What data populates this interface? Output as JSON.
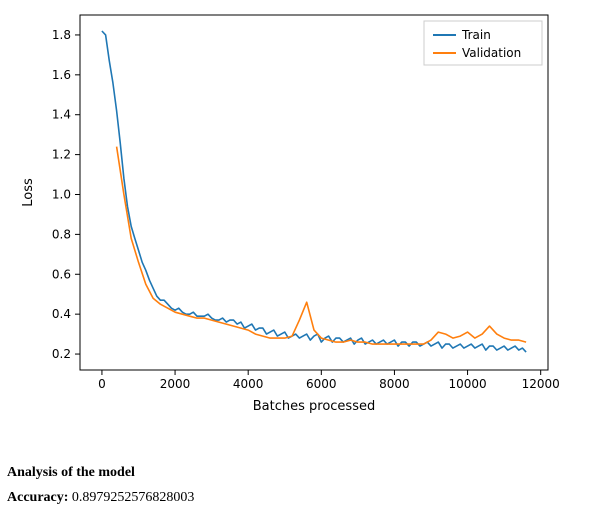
{
  "chart_data": {
    "type": "line",
    "title": "",
    "xlabel": "Batches processed",
    "ylabel": "Loss",
    "xlim": [
      -600,
      12200
    ],
    "ylim": [
      0.12,
      1.9
    ],
    "x_ticks": [
      0,
      2000,
      4000,
      6000,
      8000,
      10000,
      12000
    ],
    "y_ticks": [
      0.2,
      0.4,
      0.6,
      0.8,
      1.0,
      1.2,
      1.4,
      1.6,
      1.8
    ],
    "series": [
      {
        "name": "Train",
        "color": "#1f77b4",
        "x": [
          0,
          100,
          200,
          300,
          400,
          500,
          600,
          700,
          800,
          900,
          1000,
          1100,
          1200,
          1300,
          1400,
          1500,
          1600,
          1700,
          1800,
          1900,
          2000,
          2100,
          2200,
          2300,
          2400,
          2500,
          2600,
          2700,
          2800,
          2900,
          3000,
          3100,
          3200,
          3300,
          3400,
          3500,
          3600,
          3700,
          3800,
          3900,
          4000,
          4100,
          4200,
          4300,
          4400,
          4500,
          4600,
          4700,
          4800,
          4900,
          5000,
          5100,
          5200,
          5300,
          5400,
          5500,
          5600,
          5700,
          5800,
          5900,
          6000,
          6100,
          6200,
          6300,
          6400,
          6500,
          6600,
          6700,
          6800,
          6900,
          7000,
          7100,
          7200,
          7300,
          7400,
          7500,
          7600,
          7700,
          7800,
          7900,
          8000,
          8100,
          8200,
          8300,
          8400,
          8500,
          8600,
          8700,
          8800,
          8900,
          9000,
          9100,
          9200,
          9300,
          9400,
          9500,
          9600,
          9700,
          9800,
          9900,
          10000,
          10100,
          10200,
          10300,
          10400,
          10500,
          10600,
          10700,
          10800,
          10900,
          11000,
          11100,
          11200,
          11300,
          11400,
          11500,
          11600
        ],
        "values": [
          1.82,
          1.8,
          1.67,
          1.56,
          1.42,
          1.26,
          1.08,
          0.94,
          0.84,
          0.78,
          0.72,
          0.66,
          0.62,
          0.57,
          0.53,
          0.49,
          0.47,
          0.47,
          0.45,
          0.43,
          0.42,
          0.43,
          0.41,
          0.4,
          0.4,
          0.41,
          0.39,
          0.39,
          0.39,
          0.4,
          0.38,
          0.37,
          0.37,
          0.38,
          0.36,
          0.37,
          0.37,
          0.35,
          0.36,
          0.33,
          0.34,
          0.35,
          0.32,
          0.33,
          0.33,
          0.3,
          0.31,
          0.32,
          0.29,
          0.3,
          0.31,
          0.28,
          0.29,
          0.3,
          0.28,
          0.29,
          0.3,
          0.27,
          0.29,
          0.3,
          0.26,
          0.28,
          0.29,
          0.26,
          0.28,
          0.28,
          0.26,
          0.27,
          0.28,
          0.25,
          0.27,
          0.28,
          0.25,
          0.26,
          0.27,
          0.25,
          0.26,
          0.27,
          0.25,
          0.26,
          0.27,
          0.24,
          0.26,
          0.26,
          0.24,
          0.26,
          0.26,
          0.24,
          0.25,
          0.26,
          0.24,
          0.25,
          0.26,
          0.23,
          0.25,
          0.25,
          0.23,
          0.24,
          0.25,
          0.23,
          0.24,
          0.25,
          0.23,
          0.24,
          0.25,
          0.22,
          0.24,
          0.24,
          0.22,
          0.23,
          0.24,
          0.22,
          0.23,
          0.24,
          0.22,
          0.23,
          0.21
        ]
      },
      {
        "name": "Validation",
        "color": "#ff7f0e",
        "x": [
          400,
          600,
          800,
          1000,
          1200,
          1400,
          1600,
          1800,
          2000,
          2200,
          2400,
          2600,
          2800,
          3000,
          3200,
          3400,
          3600,
          3800,
          4000,
          4200,
          4400,
          4600,
          4800,
          5000,
          5200,
          5400,
          5600,
          5800,
          6000,
          6200,
          6400,
          6600,
          6800,
          7000,
          7200,
          7400,
          7600,
          7800,
          8000,
          8200,
          8400,
          8600,
          8800,
          9000,
          9200,
          9400,
          9600,
          9800,
          10000,
          10200,
          10400,
          10600,
          10800,
          11000,
          11200,
          11400,
          11600
        ],
        "values": [
          1.24,
          1.0,
          0.78,
          0.66,
          0.55,
          0.48,
          0.45,
          0.43,
          0.41,
          0.4,
          0.39,
          0.38,
          0.38,
          0.37,
          0.36,
          0.35,
          0.34,
          0.33,
          0.32,
          0.3,
          0.29,
          0.28,
          0.28,
          0.28,
          0.29,
          0.37,
          0.46,
          0.32,
          0.28,
          0.27,
          0.26,
          0.26,
          0.27,
          0.26,
          0.26,
          0.25,
          0.25,
          0.25,
          0.25,
          0.25,
          0.25,
          0.25,
          0.25,
          0.27,
          0.31,
          0.3,
          0.28,
          0.29,
          0.31,
          0.28,
          0.3,
          0.34,
          0.3,
          0.28,
          0.27,
          0.27,
          0.26
        ]
      }
    ],
    "legend": {
      "position": "upper right",
      "entries": [
        "Train",
        "Validation"
      ]
    }
  },
  "footer": {
    "analysis": "Analysis of the model",
    "accuracy_label": "Accuracy: ",
    "accuracy_value": "0.8979252576828003"
  }
}
